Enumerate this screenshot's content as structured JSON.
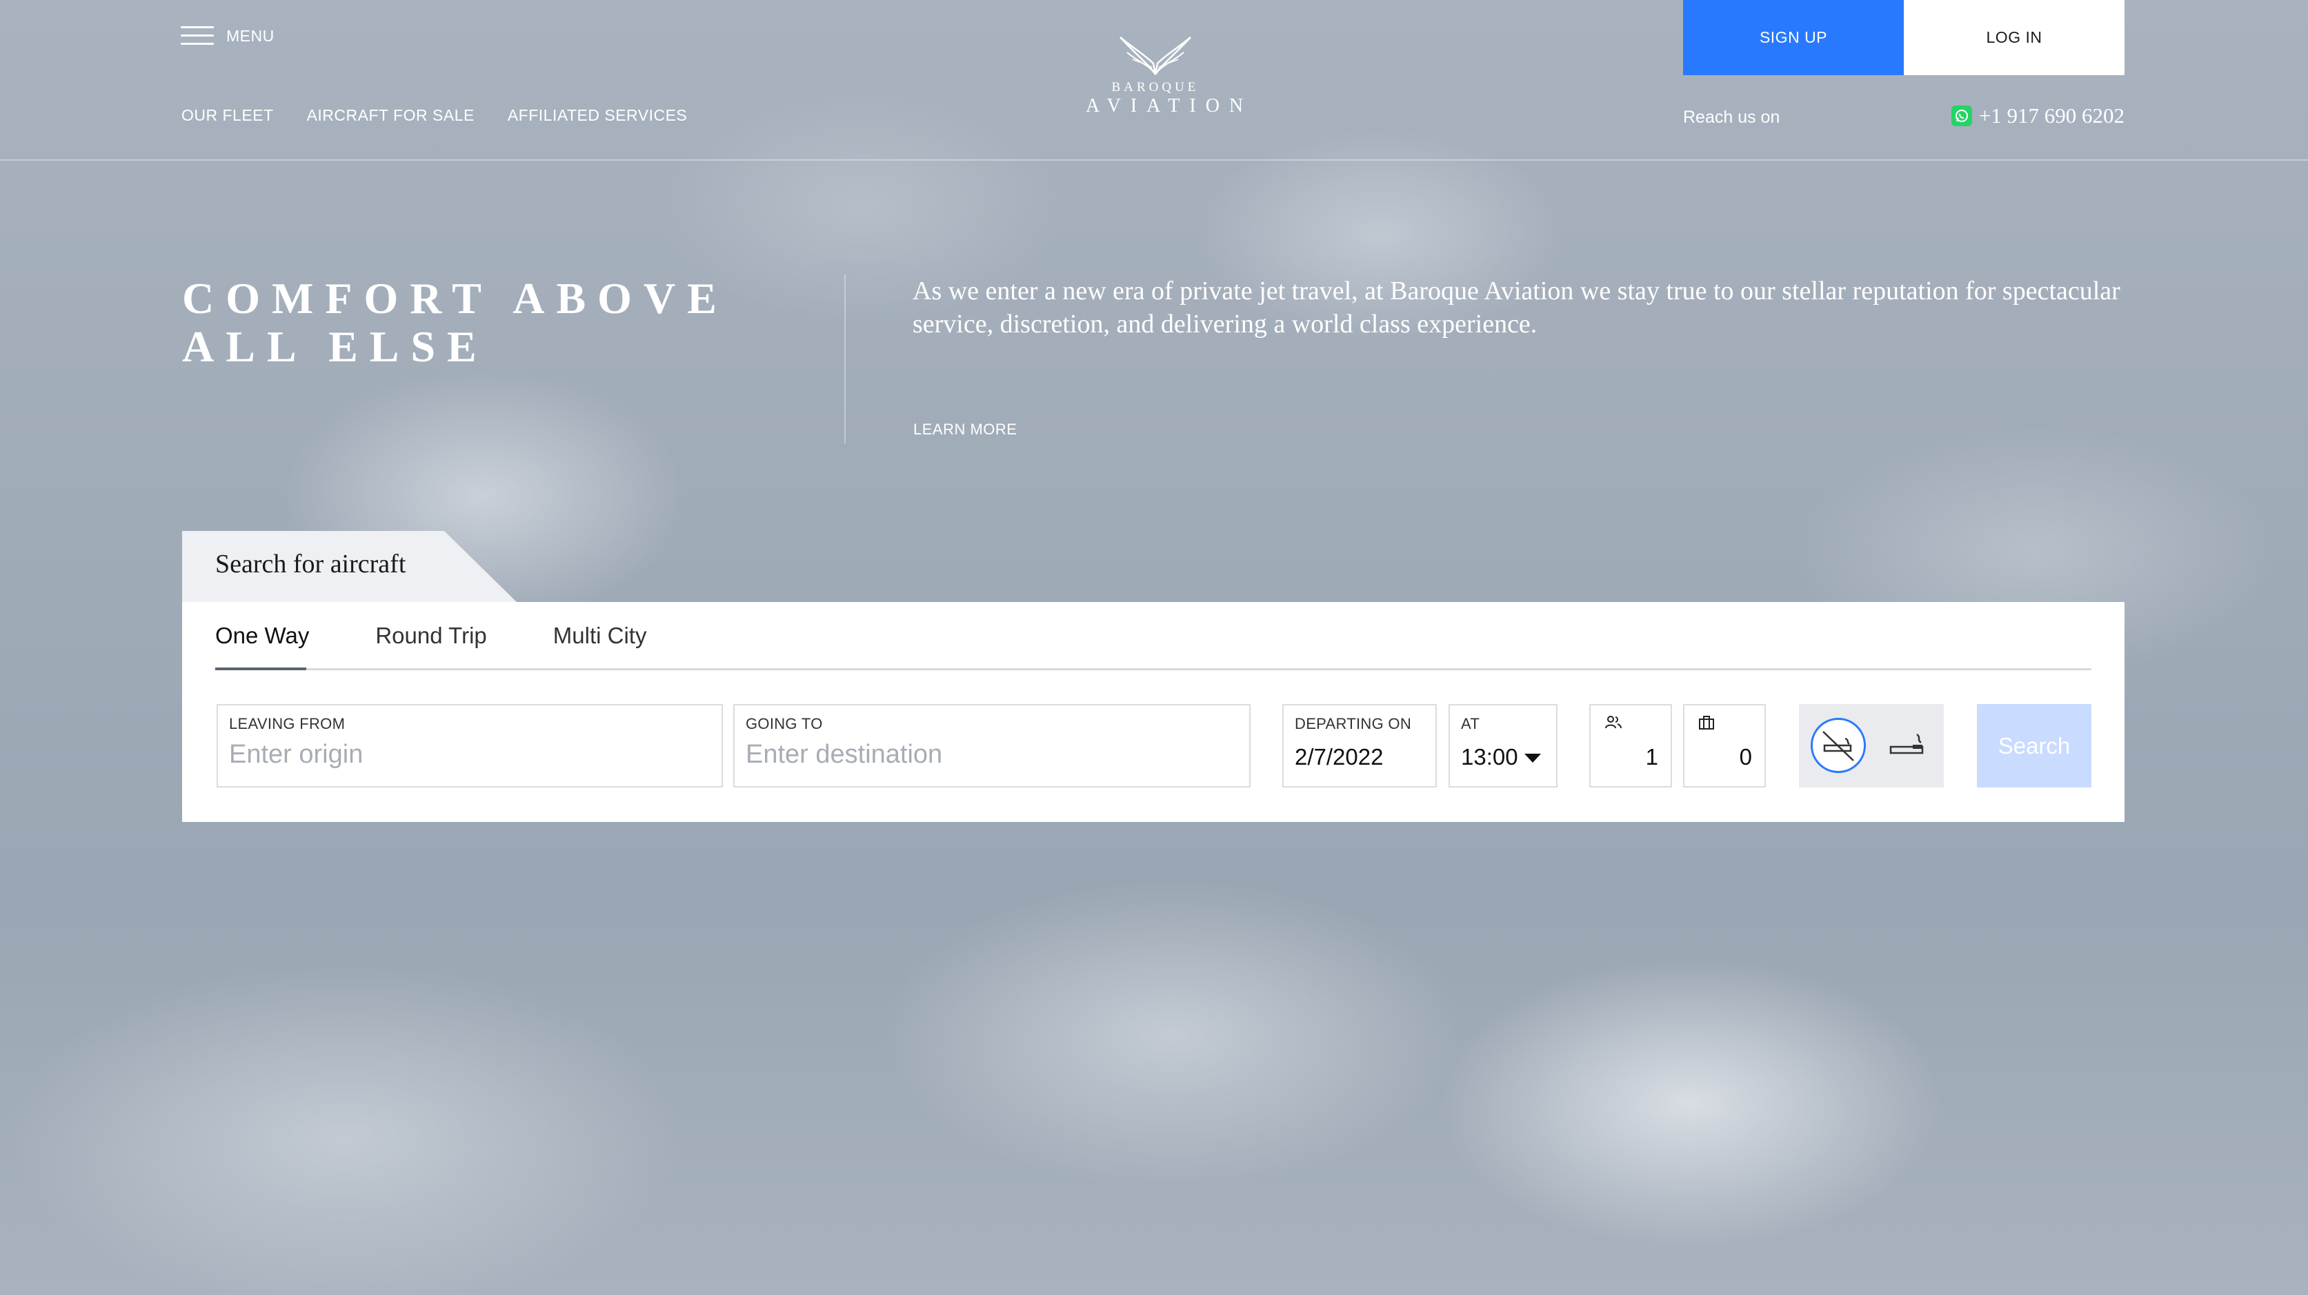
{
  "header": {
    "menu_label": "MENU",
    "nav": [
      "OUR FLEET",
      "AIRCRAFT FOR SALE",
      "AFFILIATED SERVICES"
    ],
    "logo": {
      "line1": "BAROQUE",
      "line2": "AVIATION"
    },
    "sign_up": "SIGN UP",
    "log_in": "LOG IN",
    "reach_text": "Reach us on",
    "phone": "+1 917 690 6202"
  },
  "hero": {
    "title_line1": "COMFORT ABOVE",
    "title_line2": "ALL ELSE",
    "description": "As we enter a new era of private jet travel, at Baroque Aviation we stay true to our stellar reputation for spectacular service, discretion, and delivering a world class experience.",
    "learn_more": "LEARN MORE"
  },
  "search": {
    "heading": "Search for aircraft",
    "tabs": [
      "One Way",
      "Round Trip",
      "Multi City"
    ],
    "active_tab": "One Way",
    "leaving_label": "LEAVING FROM",
    "leaving_placeholder": "Enter origin",
    "going_label": "GOING TO",
    "going_placeholder": "Enter destination",
    "departing_label": "DEPARTING ON",
    "departing_value": "2/7/2022",
    "at_label": "AT",
    "at_value": "13:00",
    "passengers": "1",
    "luggage": "0",
    "search_button": "Search"
  },
  "colors": {
    "accent": "#2979ff",
    "search_disabled": "#c9dbff",
    "whatsapp": "#25d366"
  },
  "icons": {
    "menu": "hamburger-icon",
    "logo": "wings-logo-icon",
    "whatsapp": "whatsapp-icon",
    "passengers": "passengers-icon",
    "luggage": "luggage-icon",
    "no_smoking": "no-smoking-icon",
    "smoking": "smoking-icon",
    "dropdown": "chevron-down-icon"
  }
}
